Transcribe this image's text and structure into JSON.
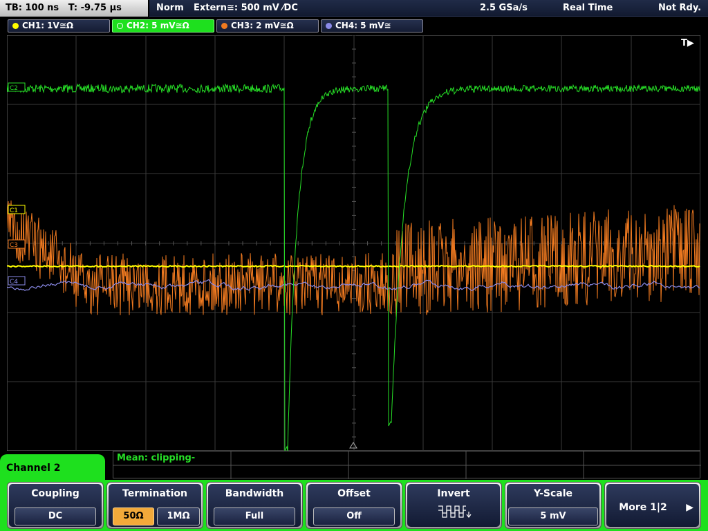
{
  "status": {
    "timebase": "TB: 100 ns   T: -9.75 µs",
    "mode": "Norm",
    "trigger": "Extern≅: 500 mV ⁄DC",
    "sample_rate": "2.5 GSa/s",
    "acq_mode": "Real Time",
    "state": "Not Rdy."
  },
  "channels": [
    {
      "label": "CH1: 1V≅Ω",
      "color": "#ffff00",
      "active": false
    },
    {
      "label": "CH2: 5 mV≅Ω",
      "color": "#27e027",
      "active": true
    },
    {
      "label": "CH3: 2 mV≅Ω",
      "color": "#f07a20",
      "active": false
    },
    {
      "label": "CH4: 5 mV≅",
      "color": "#8a8ae8",
      "active": false
    }
  ],
  "screen": {
    "trigger_marker": "T▶",
    "markers": {
      "c2": "C2",
      "c1": "C1",
      "c3": "C3",
      "c4": "C4"
    },
    "colors": {
      "ch1": "#ffff00",
      "ch2": "#27e027",
      "ch3": "#f07a20",
      "ch4": "#8a8ae8",
      "grid": "#3a3a3a"
    }
  },
  "measurement": {
    "label": "Mean: clipping-"
  },
  "menu": {
    "title": "Channel 2",
    "coupling": {
      "title": "Coupling",
      "value": "DC"
    },
    "termination": {
      "title": "Termination",
      "options": [
        "50Ω",
        "1MΩ"
      ],
      "selected": "50Ω"
    },
    "bandwidth": {
      "title": "Bandwidth",
      "value": "Full"
    },
    "offset": {
      "title": "Offset",
      "value": "Off"
    },
    "invert": {
      "title": "Invert"
    },
    "yscale": {
      "title": "Y-Scale",
      "value": "5 mV"
    },
    "more": {
      "label": "More 1|2",
      "arrow": "▶"
    }
  }
}
